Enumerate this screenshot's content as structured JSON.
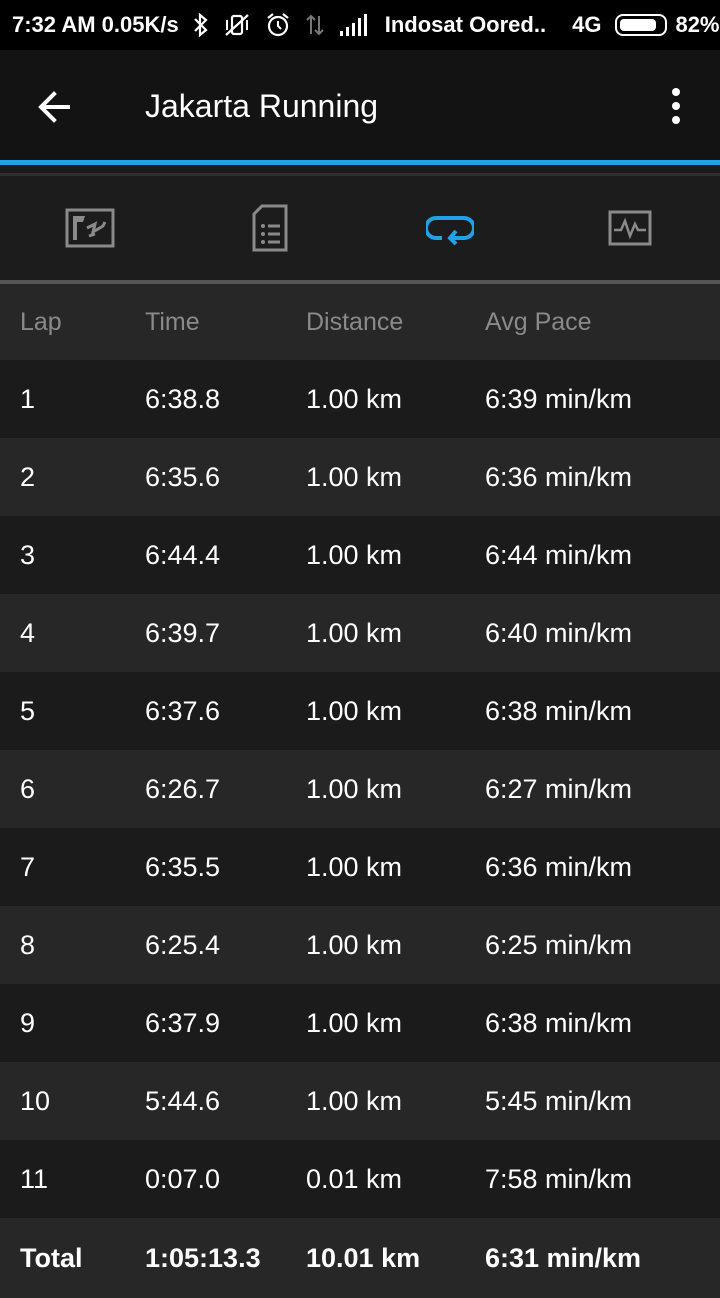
{
  "status_bar": {
    "time": "7:32 AM",
    "speed": "0.05K/s",
    "carrier": "Indosat Oored..",
    "network": "4G",
    "battery": "82%",
    "battery_level": 0.82
  },
  "app_bar": {
    "title": "Jakarta Running"
  },
  "tabs": [
    {
      "name": "map",
      "icon": "map-icon",
      "active": false
    },
    {
      "name": "details",
      "icon": "document-list-icon",
      "active": false
    },
    {
      "name": "laps",
      "icon": "lap-loop-icon",
      "active": true
    },
    {
      "name": "charts",
      "icon": "activity-chart-icon",
      "active": false
    }
  ],
  "table": {
    "headers": [
      "Lap",
      "Time",
      "Distance",
      "Avg Pace"
    ],
    "rows": [
      [
        "1",
        "6:38.8",
        "1.00 km",
        "6:39 min/km"
      ],
      [
        "2",
        "6:35.6",
        "1.00 km",
        "6:36 min/km"
      ],
      [
        "3",
        "6:44.4",
        "1.00 km",
        "6:44 min/km"
      ],
      [
        "4",
        "6:39.7",
        "1.00 km",
        "6:40 min/km"
      ],
      [
        "5",
        "6:37.6",
        "1.00 km",
        "6:38 min/km"
      ],
      [
        "6",
        "6:26.7",
        "1.00 km",
        "6:27 min/km"
      ],
      [
        "7",
        "6:35.5",
        "1.00 km",
        "6:36 min/km"
      ],
      [
        "8",
        "6:25.4",
        "1.00 km",
        "6:25 min/km"
      ],
      [
        "9",
        "6:37.9",
        "1.00 km",
        "6:38 min/km"
      ],
      [
        "10",
        "5:44.6",
        "1.00 km",
        "5:45 min/km"
      ],
      [
        "11",
        "0:07.0",
        "0.01 km",
        "7:58 min/km"
      ]
    ],
    "total": [
      "Total",
      "1:05:13.3",
      "10.01 km",
      "6:31 min/km"
    ]
  },
  "colors": {
    "accent": "#1fa2e8",
    "background": "#1b1b1b",
    "row_alt": "#272727",
    "header_text": "#8a8a8a"
  }
}
